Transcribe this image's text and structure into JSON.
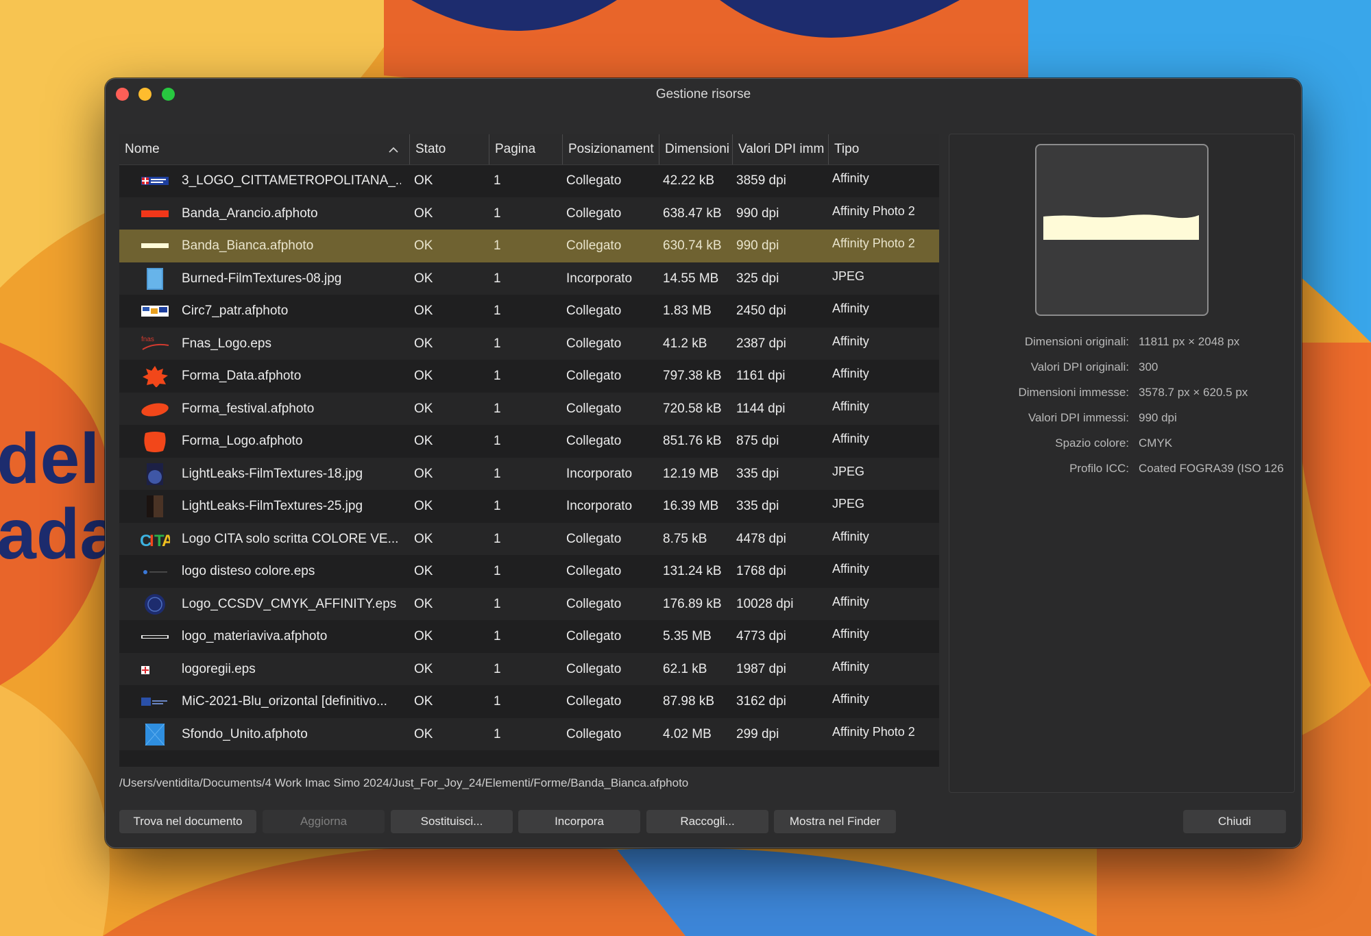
{
  "window": {
    "title": "Gestione risorse"
  },
  "table": {
    "columns": {
      "nome": "Nome",
      "stato": "Stato",
      "pagina": "Pagina",
      "posizionamento": "Posizionament",
      "dimensioni": "Dimensioni",
      "dpi": "Valori DPI imm",
      "tipo": "Tipo"
    },
    "rows": [
      {
        "nome": "3_LOGO_CITTAMETROPOLITANA_...",
        "stato": "OK",
        "pagina": "1",
        "pos": "Collegato",
        "dim": "42.22 kB",
        "dpi": "3859 dpi",
        "tipo": "Affinity",
        "thumb": "logo-flag-thumb"
      },
      {
        "nome": "Banda_Arancio.afphoto",
        "stato": "OK",
        "pagina": "1",
        "pos": "Collegato",
        "dim": "638.47 kB",
        "dpi": "990 dpi",
        "tipo": "Affinity Photo 2",
        "thumb": "orange-band-thumb"
      },
      {
        "nome": "Banda_Bianca.afphoto",
        "stato": "OK",
        "pagina": "1",
        "pos": "Collegato",
        "dim": "630.74 kB",
        "dpi": "990 dpi",
        "tipo": "Affinity Photo 2",
        "thumb": "white-band-thumb"
      },
      {
        "nome": "Burned-FilmTextures-08.jpg",
        "stato": "OK",
        "pagina": "1",
        "pos": "Incorporato",
        "dim": "14.55 MB",
        "dpi": "325 dpi",
        "tipo": "JPEG",
        "thumb": "blue-texture-thumb"
      },
      {
        "nome": "Circ7_patr.afphoto",
        "stato": "OK",
        "pagina": "1",
        "pos": "Collegato",
        "dim": "1.83 MB",
        "dpi": "2450 dpi",
        "tipo": "Affinity",
        "thumb": "logos-strip-thumb"
      },
      {
        "nome": "Fnas_Logo.eps",
        "stato": "OK",
        "pagina": "1",
        "pos": "Collegato",
        "dim": "41.2 kB",
        "dpi": "2387 dpi",
        "tipo": "Affinity",
        "thumb": "fnas-logo-thumb"
      },
      {
        "nome": "Forma_Data.afphoto",
        "stato": "OK",
        "pagina": "1",
        "pos": "Collegato",
        "dim": "797.38 kB",
        "dpi": "1161 dpi",
        "tipo": "Affinity",
        "thumb": "orange-star-thumb"
      },
      {
        "nome": "Forma_festival.afphoto",
        "stato": "OK",
        "pagina": "1",
        "pos": "Collegato",
        "dim": "720.58 kB",
        "dpi": "1144 dpi",
        "tipo": "Affinity",
        "thumb": "orange-ellipse-thumb"
      },
      {
        "nome": "Forma_Logo.afphoto",
        "stato": "OK",
        "pagina": "1",
        "pos": "Collegato",
        "dim": "851.76 kB",
        "dpi": "875 dpi",
        "tipo": "Affinity",
        "thumb": "orange-blob-thumb"
      },
      {
        "nome": "LightLeaks-FilmTextures-18.jpg",
        "stato": "OK",
        "pagina": "1",
        "pos": "Incorporato",
        "dim": "12.19 MB",
        "dpi": "335 dpi",
        "tipo": "JPEG",
        "thumb": "lightleak-blue-thumb"
      },
      {
        "nome": "LightLeaks-FilmTextures-25.jpg",
        "stato": "OK",
        "pagina": "1",
        "pos": "Incorporato",
        "dim": "16.39 MB",
        "dpi": "335 dpi",
        "tipo": "JPEG",
        "thumb": "lightleak-dark-thumb"
      },
      {
        "nome": "Logo CITA solo scritta COLORE VE...",
        "stato": "OK",
        "pagina": "1",
        "pos": "Collegato",
        "dim": "8.75 kB",
        "dpi": "4478 dpi",
        "tipo": "Affinity",
        "thumb": "cita-logo-thumb"
      },
      {
        "nome": "logo disteso colore.eps",
        "stato": "OK",
        "pagina": "1",
        "pos": "Collegato",
        "dim": "131.24 kB",
        "dpi": "1768 dpi",
        "tipo": "Affinity",
        "thumb": "small-logo-thumb"
      },
      {
        "nome": "Logo_CCSDV_CMYK_AFFINITY.eps",
        "stato": "OK",
        "pagina": "1",
        "pos": "Collegato",
        "dim": "176.89 kB",
        "dpi": "10028 dpi",
        "tipo": "Affinity",
        "thumb": "circle-logo-thumb"
      },
      {
        "nome": "logo_materiaviva.afphoto",
        "stato": "OK",
        "pagina": "1",
        "pos": "Collegato",
        "dim": "5.35 MB",
        "dpi": "4773 dpi",
        "tipo": "Affinity",
        "thumb": "text-logo-thumb"
      },
      {
        "nome": "logoregii.eps",
        "stato": "OK",
        "pagina": "1",
        "pos": "Collegato",
        "dim": "62.1 kB",
        "dpi": "1987 dpi",
        "tipo": "Affinity",
        "thumb": "red-cross-thumb"
      },
      {
        "nome": "MiC-2021-Blu_orizontal [definitivo...",
        "stato": "OK",
        "pagina": "1",
        "pos": "Collegato",
        "dim": "87.98 kB",
        "dpi": "3162 dpi",
        "tipo": "Affinity",
        "thumb": "mic-logo-thumb"
      },
      {
        "nome": "Sfondo_Unito.afphoto",
        "stato": "OK",
        "pagina": "1",
        "pos": "Collegato",
        "dim": "4.02 MB",
        "dpi": "299 dpi",
        "tipo": "Affinity Photo 2",
        "thumb": "blue-background-thumb"
      }
    ],
    "selected_index": 2
  },
  "details": {
    "labels": {
      "orig_dim": "Dimensioni originali:",
      "orig_dpi": "Valori DPI originali:",
      "placed_dim": "Dimensioni immesse:",
      "placed_dpi": "Valori DPI immessi:",
      "color_space": "Spazio colore:",
      "icc": "Profilo ICC:"
    },
    "values": {
      "orig_dim": "11811 px × 2048 px",
      "orig_dpi": "300",
      "placed_dim": "3578.7 px × 620.5 px",
      "placed_dpi": "990 dpi",
      "color_space": "CMYK",
      "icc": "Coated FOGRA39 (ISO 126"
    }
  },
  "path": "/Users/ventidita/Documents/4 Work Imac Simo 2024/Just_For_Joy_24/Elementi/Forme/Banda_Bianca.afphoto",
  "buttons": {
    "find": "Trova nel documento",
    "update": "Aggiorna",
    "replace": "Sostituisci...",
    "embed": "Incorpora",
    "collect": "Raccogli...",
    "finder": "Mostra nel Finder",
    "close": "Chiudi"
  },
  "colors": {
    "selected_row": "#6f6231",
    "accent_orange": "#f04a1c",
    "band_cream": "#fffbd8"
  }
}
